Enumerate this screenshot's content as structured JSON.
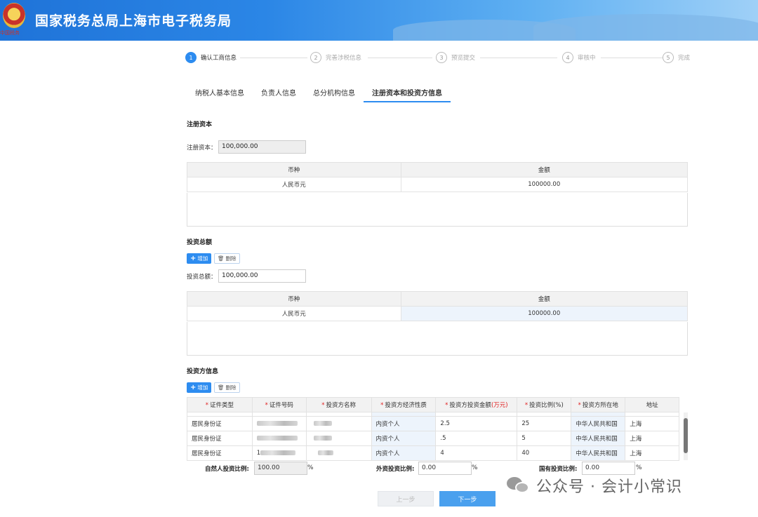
{
  "header": {
    "title": "国家税务总局上海市电子税务局",
    "emblem_caption": "中国税务"
  },
  "steps": [
    {
      "num": "1",
      "label": "确认工商信息"
    },
    {
      "num": "2",
      "label": "完善涉税信息"
    },
    {
      "num": "3",
      "label": "预览提交"
    },
    {
      "num": "4",
      "label": "审核中"
    },
    {
      "num": "5",
      "label": "完成"
    }
  ],
  "tabs": [
    "纳税人基本信息",
    "负责人信息",
    "总分机构信息",
    "注册资本和投资方信息"
  ],
  "registered": {
    "section_title": "注册资本",
    "field_label": "注册资本：",
    "field_value": "100,000.00",
    "col_currency": "币种",
    "col_amount": "金额",
    "row_currency": "人民币元",
    "row_amount": "100000.00"
  },
  "investment": {
    "section_title": "投资总额",
    "add_label": "增加",
    "delete_label": "删除",
    "field_label": "投资总额：",
    "field_value": "100,000.00",
    "col_currency": "币种",
    "col_amount": "金额",
    "row_currency": "人民币元",
    "row_amount": "100000.00"
  },
  "investor": {
    "section_title": "投资方信息",
    "add_label": "增加",
    "delete_label": "删除",
    "headers": {
      "id_type": "证件类型",
      "id_number": "证件号码",
      "name": "投资方名称",
      "nature": "投资方经济性质",
      "amount": "投资方投资金额",
      "amount_unit": "(万元)",
      "ratio": "投资比例(%)",
      "location": "投资方所在地",
      "address": "地址"
    },
    "rows": [
      {
        "id_type": "居民身份证",
        "id_prefix": "",
        "nature": "内资个人",
        "amount": "2.5",
        "ratio": "25",
        "location": "中华人民共和国",
        "address": "上海"
      },
      {
        "id_type": "居民身份证",
        "id_prefix": "",
        "nature": "内资个人",
        "amount": ".5",
        "ratio": "5",
        "location": "中华人民共和国",
        "address": "上海"
      },
      {
        "id_type": "居民身份证",
        "id_prefix": "1",
        "nature": "内资个人",
        "amount": "4",
        "ratio": "40",
        "location": "中华人民共和国",
        "address": "上海"
      }
    ]
  },
  "ratios": {
    "natural_label": "自然人投资比例:",
    "natural_value": "100.00",
    "foreign_label": "外资投资比例:",
    "foreign_value": "0.00",
    "state_label": "国有投资比例:",
    "state_value": "0.00",
    "percent": "%"
  },
  "buttons": {
    "prev": "上一步",
    "next": "下一步"
  },
  "watermark": {
    "text": "公众号 · 会计小常识"
  }
}
